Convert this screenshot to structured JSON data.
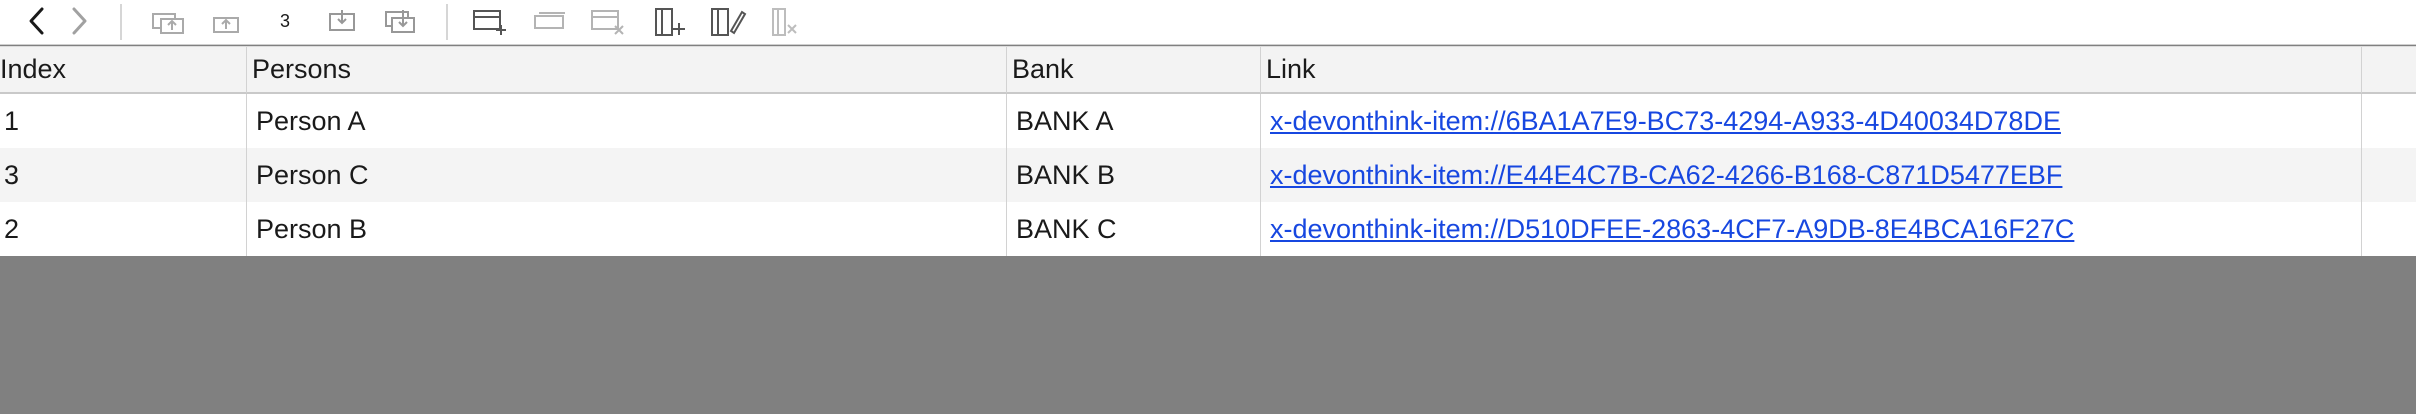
{
  "toolbar": {
    "back_icon": "chevron-left-icon",
    "forward_icon": "chevron-right-icon",
    "record_count": "3",
    "icons": [
      "move-up-icon",
      "move-up-alt-icon",
      "move-down-icon",
      "move-down-alt-icon",
      "add-row-icon",
      "duplicate-row-icon",
      "delete-row-icon",
      "add-column-icon",
      "edit-column-icon",
      "delete-column-icon"
    ]
  },
  "table": {
    "columns": [
      "Index",
      "Persons",
      "Bank",
      "Link"
    ],
    "rows": [
      {
        "index": "1",
        "person": "Person A",
        "bank": "BANK A",
        "link": "x-devonthink-item://6BA1A7E9-BC73-4294-A933-4D40034D78DE"
      },
      {
        "index": "3",
        "person": "Person C",
        "bank": "BANK B",
        "link": "x-devonthink-item://E44E4C7B-CA62-4266-B168-C871D5477EBF"
      },
      {
        "index": "2",
        "person": "Person B",
        "bank": "BANK C",
        "link": "x-devonthink-item://D510DFEE-2863-4CF7-A9DB-8E4BCA16F27C"
      }
    ]
  },
  "colors": {
    "link": "#1747e0",
    "empty_area": "#808080",
    "header_bg": "#f3f3f3",
    "alt_row_bg": "#f4f4f4"
  }
}
